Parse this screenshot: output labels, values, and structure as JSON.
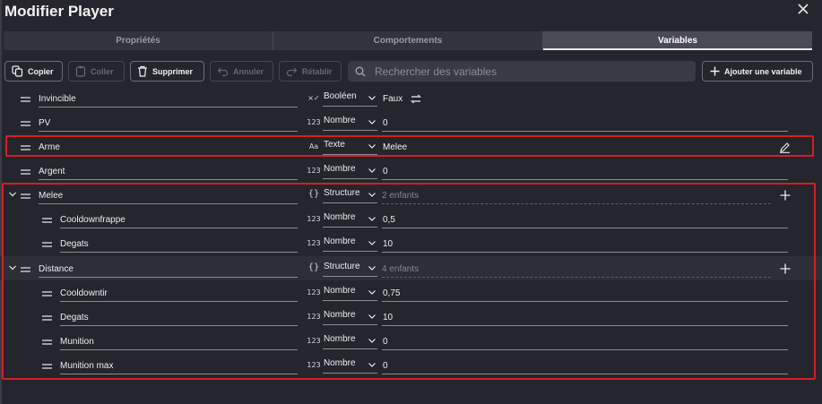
{
  "window": {
    "title": "Modifier Player"
  },
  "tabs": [
    {
      "label": "Propriétés",
      "active": false
    },
    {
      "label": "Comportements",
      "active": false
    },
    {
      "label": "Variables",
      "active": true
    }
  ],
  "toolbar": {
    "copy": "Copier",
    "paste": "Coller",
    "delete": "Supprimer",
    "undo": "Annuler",
    "redo": "Rétablir",
    "search_placeholder": "Rechercher des variables",
    "add": "Ajouter une variable"
  },
  "type_icons": {
    "number": "123",
    "boolean": "×✓",
    "text": "Aa",
    "structure": "{}"
  },
  "variables": [
    {
      "name": "Invincible",
      "type": "Booléen",
      "value": "Faux"
    },
    {
      "name": "PV",
      "type": "Nombre",
      "value": "0"
    },
    {
      "name": "Arme",
      "type": "Texte",
      "value": "Melee"
    },
    {
      "name": "Argent",
      "type": "Nombre",
      "value": "0"
    },
    {
      "name": "Melee",
      "type": "Structure",
      "children": "2 enfants",
      "items": [
        {
          "name": "Cooldownfrappe",
          "type": "Nombre",
          "value": "0,5"
        },
        {
          "name": "Degats",
          "type": "Nombre",
          "value": "10"
        }
      ]
    },
    {
      "name": "Distance",
      "type": "Structure",
      "children": "4 enfants",
      "items": [
        {
          "name": "Cooldowntir",
          "type": "Nombre",
          "value": "0,75"
        },
        {
          "name": "Degats",
          "type": "Nombre",
          "value": "10"
        },
        {
          "name": "Munition",
          "type": "Nombre",
          "value": "0"
        },
        {
          "name": "Munition max",
          "type": "Nombre",
          "value": "0"
        }
      ]
    }
  ],
  "colors": {
    "background": "#25252d",
    "highlight": "#d42020",
    "tab_active": "#4a4a55"
  }
}
